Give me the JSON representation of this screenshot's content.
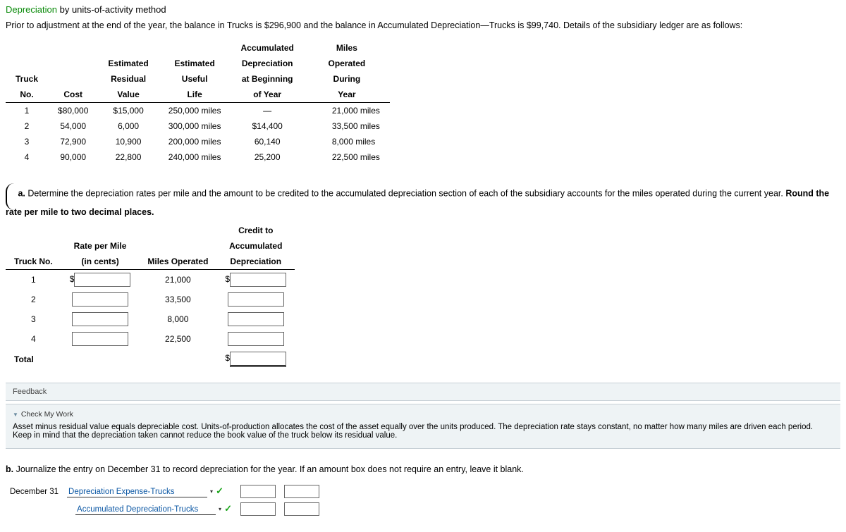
{
  "title_link": "Depreciation",
  "title_rest": " by units-of-activity method",
  "intro": "Prior to adjustment at the end of the year, the balance in Trucks is $296,900 and the balance in Accumulated Depreciation—Trucks is $99,740. Details of the subsidiary ledger are as follows:",
  "ledger_headers": {
    "c1a": "Truck",
    "c1b": "No.",
    "c2": "Cost",
    "c3a": "Estimated",
    "c3b": "Residual",
    "c3c": "Value",
    "c4a": "Estimated",
    "c4b": "Useful",
    "c4c": "Life",
    "c5a": "Accumulated",
    "c5b": "Depreciation",
    "c5c": "at Beginning",
    "c5d": "of Year",
    "c6a": "Miles",
    "c6b": "Operated",
    "c6c": "During",
    "c6d": "Year"
  },
  "ledger_rows": [
    {
      "no": "1",
      "cost": "$80,000",
      "resid": "$15,000",
      "life": "250,000 miles",
      "accum": "—",
      "miles": "21,000 miles"
    },
    {
      "no": "2",
      "cost": "54,000",
      "resid": "6,000",
      "life": "300,000 miles",
      "accum": "$14,400",
      "miles": "33,500 miles"
    },
    {
      "no": "3",
      "cost": "72,900",
      "resid": "10,900",
      "life": "200,000 miles",
      "accum": "60,140",
      "miles": "8,000 miles"
    },
    {
      "no": "4",
      "cost": "90,000",
      "resid": "22,800",
      "life": "240,000 miles",
      "accum": "25,200",
      "miles": "22,500 miles"
    }
  ],
  "qa_prefix": "a.",
  "qa_text": "  Determine the depreciation rates per mile and the amount to be credited to the accumulated depreciation section of each of the subsidiary accounts for the miles operated during the current year. ",
  "qa_bold": "Round the rate per mile to two decimal places.",
  "calc_headers": {
    "c1": "Truck No.",
    "c2a": "Rate per Mile",
    "c2b": "(in cents)",
    "c3": "Miles Operated",
    "c4a": "Credit to",
    "c4b": "Accumulated",
    "c4c": "Depreciation"
  },
  "calc_rows": [
    {
      "no": "1",
      "miles": "21,000",
      "rate_prefix": "$",
      "credit_prefix": "$"
    },
    {
      "no": "2",
      "miles": "33,500",
      "rate_prefix": "",
      "credit_prefix": ""
    },
    {
      "no": "3",
      "miles": "8,000",
      "rate_prefix": "",
      "credit_prefix": ""
    },
    {
      "no": "4",
      "miles": "22,500",
      "rate_prefix": "",
      "credit_prefix": ""
    }
  ],
  "total_label": "Total",
  "total_prefix": "$",
  "feedback_label": "Feedback",
  "cmw_label": "Check My Work",
  "hint_text": "Asset minus residual value equals depreciable cost. Units-of-production allocates the cost of the asset equally over the units produced. The depreciation rate stays constant, no matter how many miles are driven each period. Keep in mind that the depreciation taken cannot reduce the book value of the truck below its residual value.",
  "qb_prefix": "b.",
  "qb_text": "  Journalize the entry on December 31 to record depreciation for the year. If an amount box does not require an entry, leave it blank.",
  "journal_date": "December 31",
  "journal_acct1": "Depreciation Expense-Trucks",
  "journal_acct2": "Accumulated Depreciation-Trucks"
}
